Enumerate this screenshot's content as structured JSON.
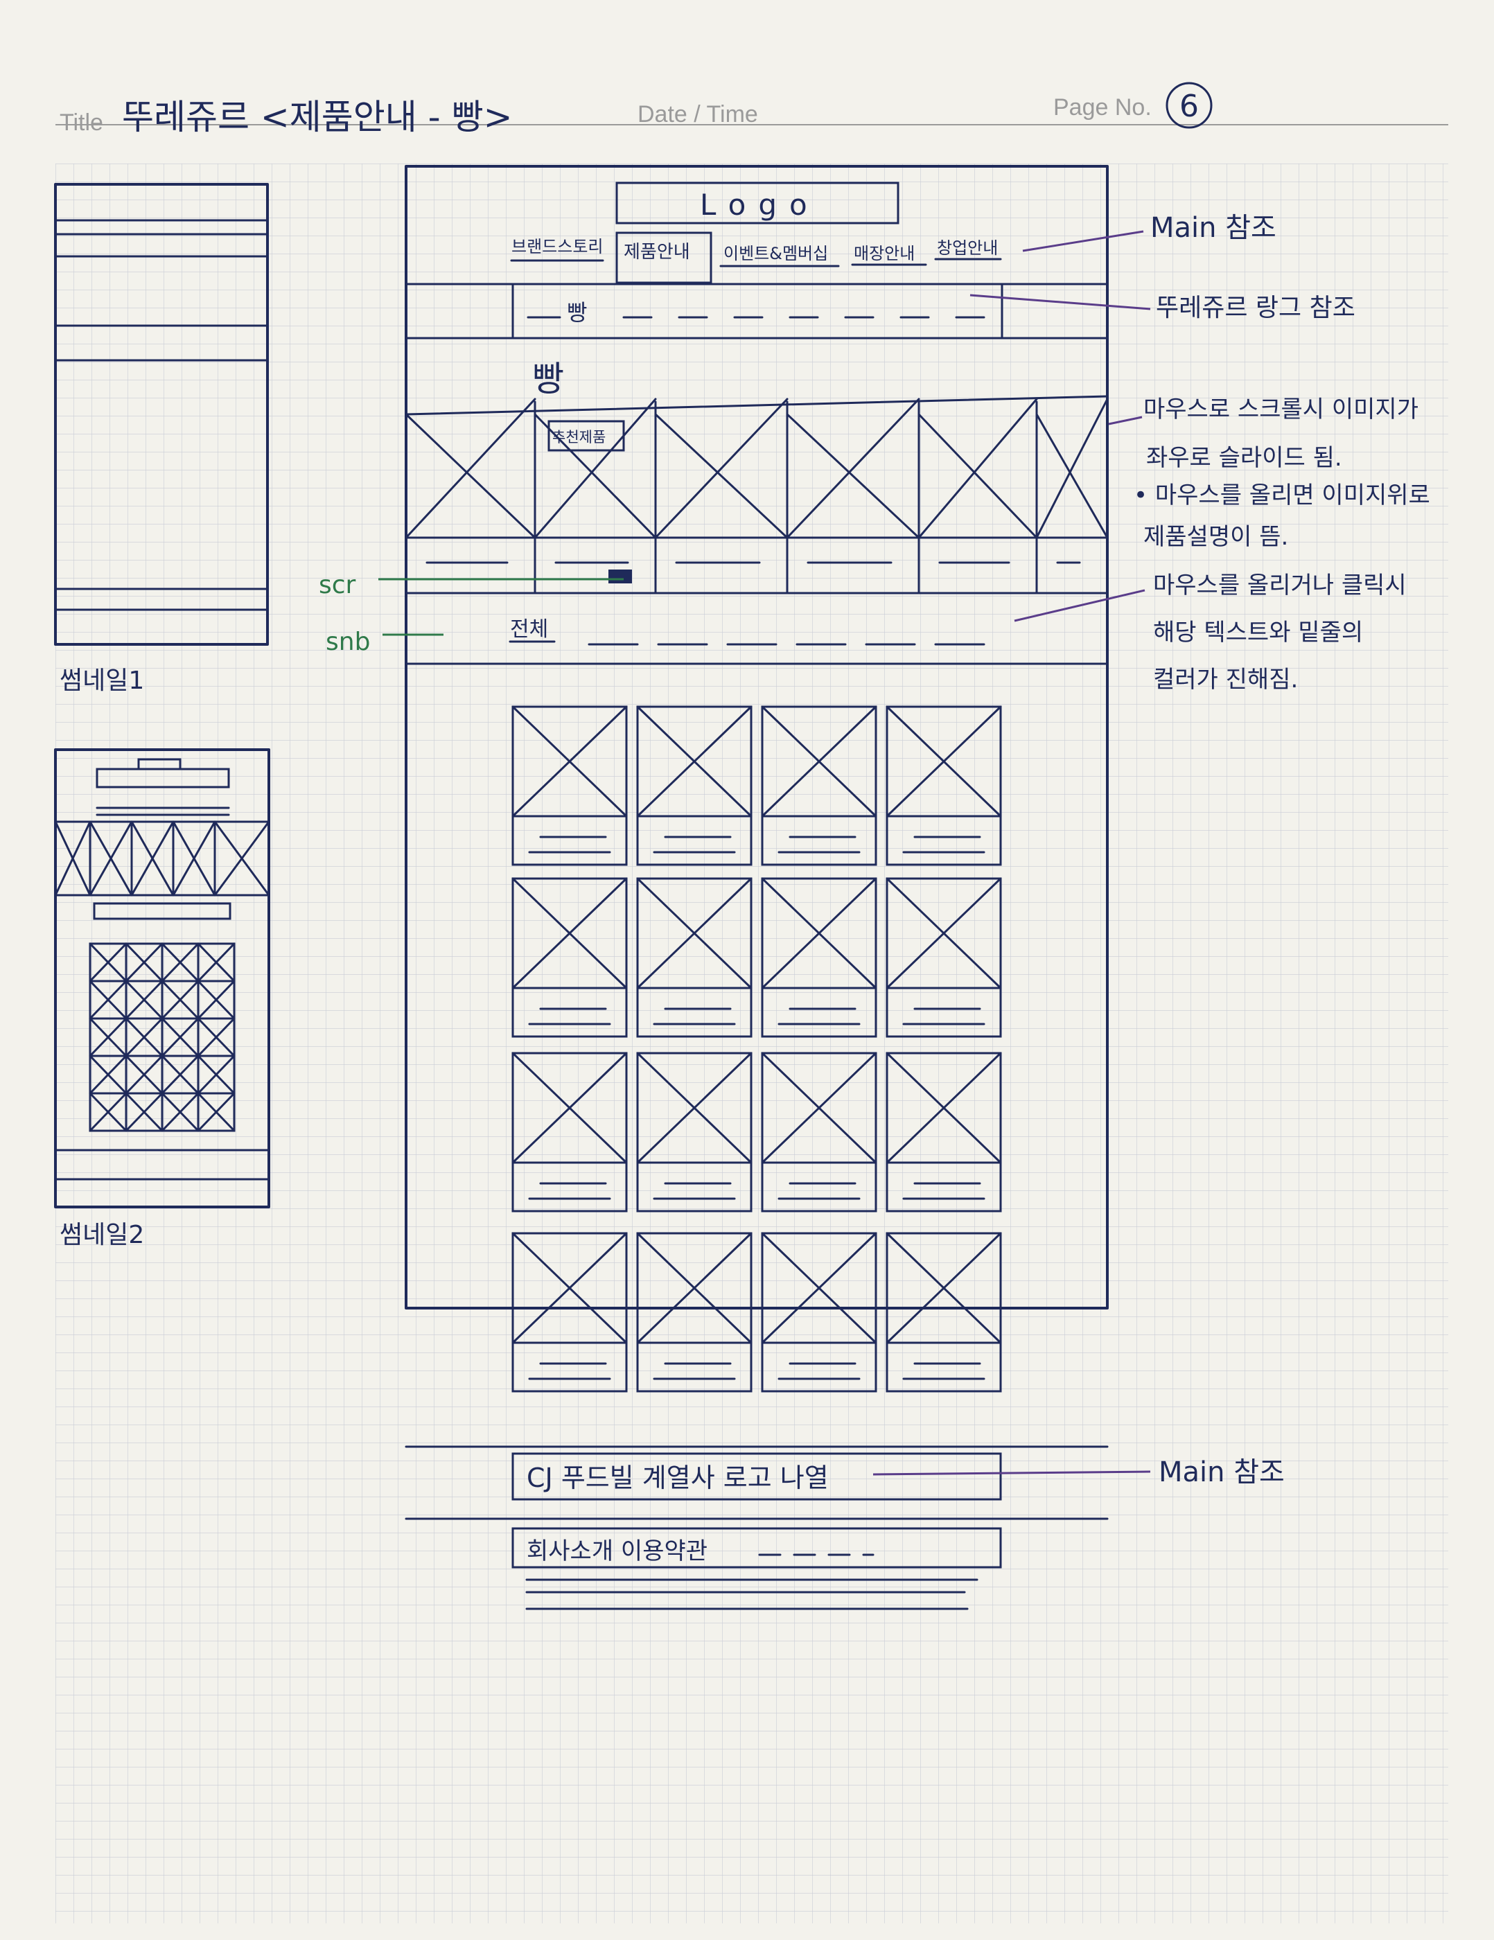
{
  "header": {
    "title_label": "Title",
    "title": "뚜레쥬르 <제품안내 - 빵>",
    "date_label": "Date / Time",
    "page_label": "Page No.",
    "page_number": "6"
  },
  "page": {
    "logo": "Logo",
    "nav": [
      "브랜드스토리",
      "제품안내",
      "이벤트&멤버십",
      "매장안내",
      "창업안내"
    ],
    "breadcrumb": "빵",
    "section_title": "빵",
    "badge": "추천제품",
    "sub_nav_first": "전체",
    "footer_families": "CJ 푸드빌 계열사 로고 나열",
    "footer_links": "회사소개   이용약관"
  },
  "thumbnails": {
    "thumb1_label": "썸네일1",
    "thumb2_label": "썸네일2"
  },
  "side_labels": {
    "scr": "scr",
    "snb": "snb"
  },
  "annotations": {
    "nav_ref": "Main 참조",
    "breadcrumb_ref": "뚜레쥬르 랑그 참조",
    "slider_note_1": "마우스로 스크롤시 이미지가",
    "slider_note_2": "좌우로 슬라이드 됨.",
    "slider_note_3": "• 마우스를 올리면 이미지위로",
    "slider_note_4": "제품설명이 뜸.",
    "snb_note_1": "마우스를 올리거나 클릭시",
    "snb_note_2": "해당 텍스트와 밑줄의",
    "snb_note_3": "컬러가 진해짐.",
    "footer_ref": "Main 참조"
  },
  "colors": {
    "paper": "#f3f2ec",
    "grid": "#c9ccd6",
    "ink": "#1f2a5a",
    "leader": "#5a3d8a",
    "green": "#2f7a4a"
  }
}
